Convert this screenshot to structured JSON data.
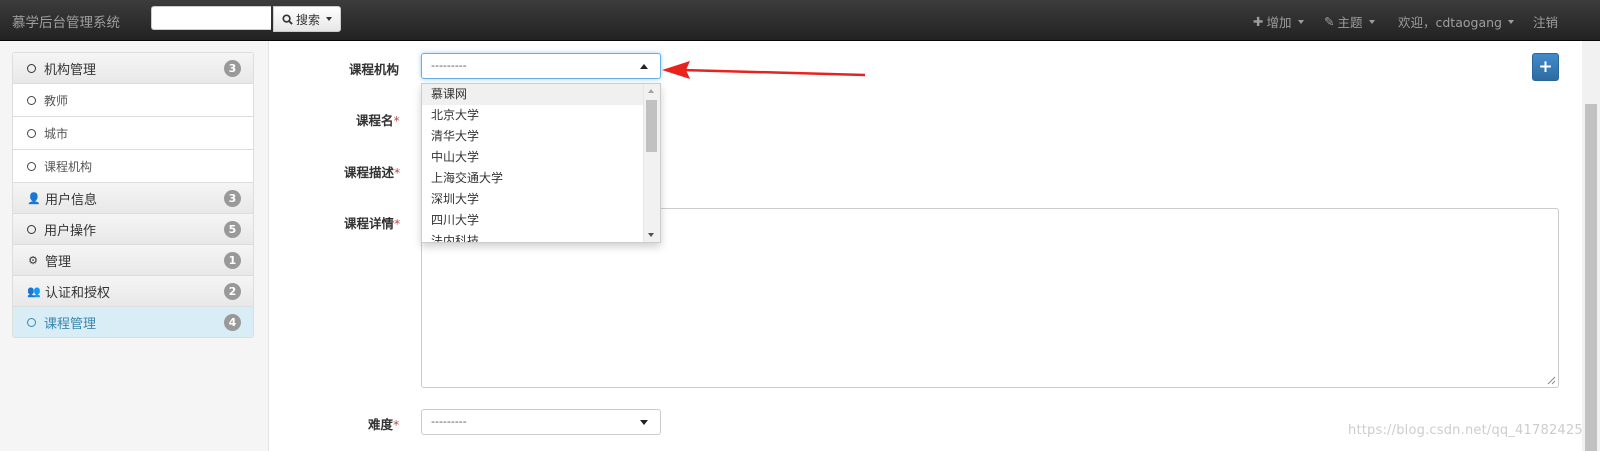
{
  "header": {
    "brand": "慕学后台管理系统",
    "search_placeholder": "",
    "search_button": "搜索",
    "add_menu": "增加",
    "theme_menu": "主题",
    "welcome": "欢迎，cdtaogang",
    "logout": "注销"
  },
  "sidebar": {
    "groups": [
      {
        "label": "机构管理",
        "icon": "circle-icon",
        "badge": "3",
        "items": [
          "教师",
          "城市",
          "课程机构"
        ]
      },
      {
        "label": "用户信息",
        "icon": "user-icon",
        "badge": "3"
      },
      {
        "label": "用户操作",
        "icon": "circle-icon",
        "badge": "5"
      },
      {
        "label": "管理",
        "icon": "gear-icon",
        "badge": "1"
      },
      {
        "label": "认证和授权",
        "icon": "users-icon",
        "badge": "2"
      },
      {
        "label": "课程管理",
        "icon": "circle-icon",
        "badge": "4",
        "active": true
      }
    ]
  },
  "form": {
    "org_label": "课程机构",
    "org_value": "---------",
    "name_label": "课程名",
    "desc_label": "课程描述",
    "detail_label": "课程详情",
    "degree_label": "难度",
    "degree_value": "---------",
    "required_mark": "*",
    "org_options": [
      "慕课网",
      "北京大学",
      "清华大学",
      "中山大学",
      "上海交通大学",
      "深圳大学",
      "四川大学",
      "法内科技"
    ]
  },
  "add_button": "+",
  "watermark": "https://blog.csdn.net/qq_41782425",
  "colors": {
    "accent": "#428bca",
    "active_bg": "#d9edf7",
    "active_text": "#3a87ad",
    "arrow": "#e8221d"
  }
}
